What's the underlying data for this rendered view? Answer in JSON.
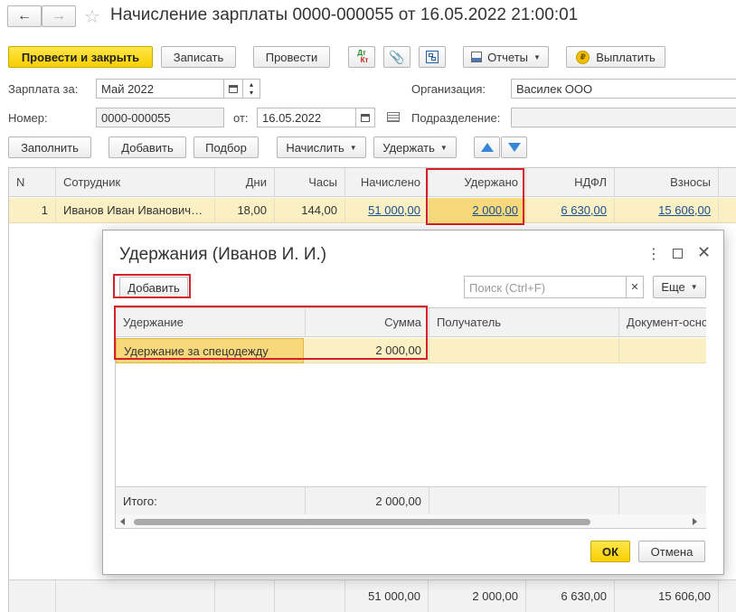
{
  "window": {
    "title": "Начисление зарплаты 0000-000055 от 16.05.2022 21:00:01"
  },
  "toolbar": {
    "post_close": "Провести и закрыть",
    "save": "Записать",
    "post": "Провести",
    "dtkt_top": "Дт",
    "dtkt_bottom": "Кт",
    "reports": "Отчеты",
    "pay": "Выплатить"
  },
  "form": {
    "salary_for_label": "Зарплата за:",
    "salary_for_value": "Май 2022",
    "org_label": "Организация:",
    "org_value": "Василек ООО",
    "number_label": "Номер:",
    "number_value": "0000-000055",
    "date_from_label": "от:",
    "date_value": "16.05.2022",
    "division_label": "Подразделение:",
    "division_value": ""
  },
  "table_toolbar": {
    "fill": "Заполнить",
    "add": "Добавить",
    "pick": "Подбор",
    "accrue": "Начислить",
    "withhold": "Удержать"
  },
  "main_table": {
    "headers": [
      "N",
      "Сотрудник",
      "Дни",
      "Часы",
      "Начислено",
      "Удержано",
      "НДФЛ",
      "Взносы"
    ],
    "row": {
      "n": "1",
      "employee": "Иванов Иван Иванович…",
      "days": "18,00",
      "hours": "144,00",
      "accrued": "51 000,00",
      "withheld": "2 000,00",
      "ndfl": "6 630,00",
      "contrib": "15 606,00"
    },
    "totals": {
      "accrued": "51 000,00",
      "withheld": "2 000,00",
      "ndfl": "6 630,00",
      "contrib": "15 606,00"
    }
  },
  "dialog": {
    "title": "Удержания (Иванов И. И.)",
    "add": "Добавить",
    "search_placeholder": "Поиск (Ctrl+F)",
    "more": "Еще",
    "headers": [
      "Удержание",
      "Сумма",
      "Получатель",
      "Документ-осно"
    ],
    "row": {
      "deduction": "Удержание за спецодежду",
      "amount": "2 000,00",
      "recipient": "",
      "doc": ""
    },
    "total_label": "Итого:",
    "total_amount": "2 000,00",
    "ok": "ОК",
    "cancel": "Отмена"
  }
}
